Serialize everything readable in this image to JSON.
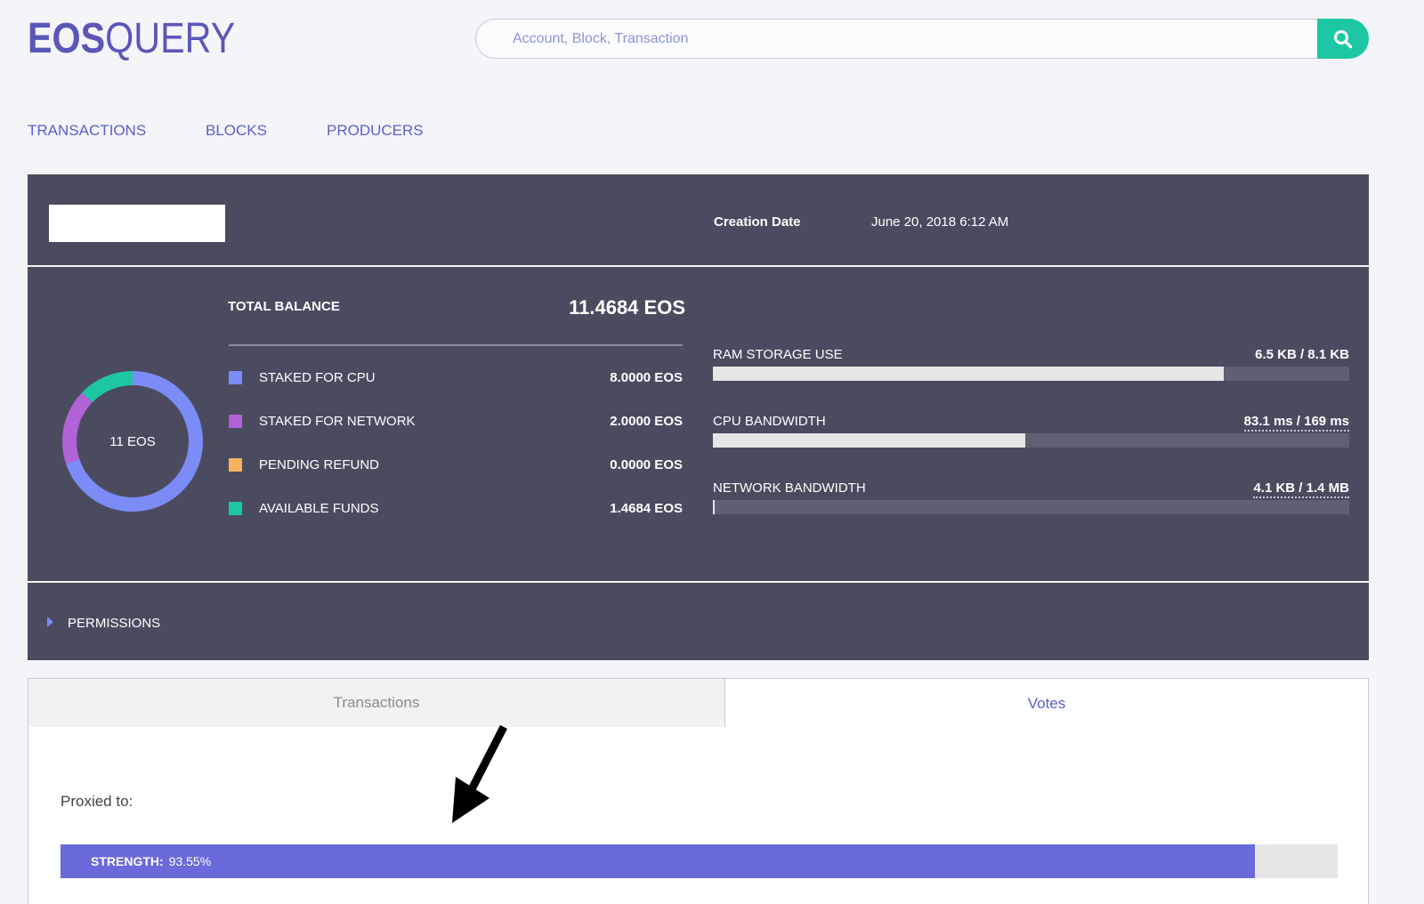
{
  "brand": {
    "bold": "EOS",
    "light": "QUERY",
    "color": "#5a57b9"
  },
  "search": {
    "placeholder": "Account, Block, Transaction",
    "button_icon": "search-icon",
    "button_color": "#1ec7a4"
  },
  "nav": {
    "items": [
      {
        "label": "TRANSACTIONS"
      },
      {
        "label": "BLOCKS"
      },
      {
        "label": "PRODUCERS"
      }
    ]
  },
  "account": {
    "creation_label": "Creation Date",
    "creation_value": "June 20, 2018 6:12 AM"
  },
  "balance": {
    "donut_label": "11 EOS",
    "total_label": "TOTAL BALANCE",
    "total_value": "11.4684 EOS",
    "items": [
      {
        "label": "STAKED FOR CPU",
        "value": "8.0000 EOS",
        "amount": 8.0,
        "color": "#7b8cf7"
      },
      {
        "label": "STAKED FOR NETWORK",
        "value": "2.0000 EOS",
        "amount": 2.0,
        "color": "#b062d6"
      },
      {
        "label": "PENDING REFUND",
        "value": "0.0000 EOS",
        "amount": 0.0,
        "color": "#f7b35e"
      },
      {
        "label": "AVAILABLE FUNDS",
        "value": "1.4684 EOS",
        "amount": 1.4684,
        "color": "#1ec7a4"
      }
    ]
  },
  "resources": [
    {
      "label": "RAM STORAGE USE",
      "value": "6.5 KB / 8.1 KB",
      "fraction": 0.803,
      "dotted": false
    },
    {
      "label": "CPU BANDWIDTH",
      "value": "83.1 ms / 169 ms",
      "fraction": 0.491,
      "dotted": true
    },
    {
      "label": "NETWORK BANDWIDTH",
      "value": "4.1 KB / 1.4 MB",
      "fraction": 0.003,
      "dotted": true
    }
  ],
  "permissions": {
    "label": "PERMISSIONS"
  },
  "tabs": {
    "transactions": "Transactions",
    "votes": "Votes"
  },
  "votes": {
    "proxied_label": "Proxied to:",
    "strength_label": "STRENGTH:",
    "strength_value": "93.55%",
    "strength_fraction": 0.9355
  }
}
